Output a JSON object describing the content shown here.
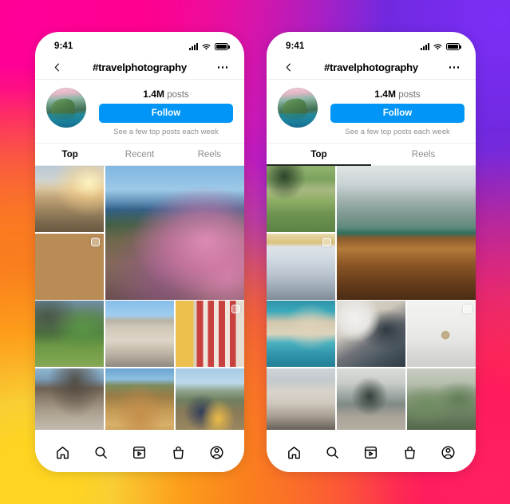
{
  "background": {
    "gradient_colors": [
      "#FF0099",
      "#7B2FF7",
      "#FF1B5C",
      "#FA7E1E",
      "#FFD521"
    ]
  },
  "accent": {
    "brand_blue": "#0095F6",
    "text_primary": "#000000",
    "text_muted": "#8e8e8e"
  },
  "phones": [
    {
      "id": "phone-left",
      "status": {
        "time": "9:41",
        "signal_icon": "cellular-bars-icon",
        "wifi_icon": "wifi-icon",
        "battery_icon": "battery-icon"
      },
      "header": {
        "back_icon": "chevron-left-icon",
        "title": "#travelphotography",
        "menu_icon": "more-options-icon"
      },
      "profile": {
        "avatar_name": "hashtag-avatar",
        "posts_count": "1.4M",
        "posts_label": "posts",
        "follow_label": "Follow",
        "subtext": "See a few top posts each week"
      },
      "tabs": [
        {
          "label": "Top",
          "active": true,
          "underline": false
        },
        {
          "label": "Recent",
          "active": false,
          "underline": false
        },
        {
          "label": "Reels",
          "active": false,
          "underline": false
        }
      ],
      "grid": [
        {
          "name": "post-beach-sunset",
          "art": "p-beach",
          "big": false,
          "badge": false
        },
        {
          "name": "post-coastal-flowers",
          "art": "p-flowers",
          "big": true,
          "badge": false
        },
        {
          "name": "post-coffee-cake",
          "art": "p-coffee",
          "big": false,
          "badge": true
        },
        {
          "name": "post-palm-garden",
          "art": "p-palm",
          "big": false,
          "badge": false
        },
        {
          "name": "post-stone-archway",
          "art": "p-arch",
          "big": false,
          "badge": false
        },
        {
          "name": "post-striped-wall-shadow",
          "art": "p-stripes",
          "big": false,
          "badge": true
        },
        {
          "name": "post-pebble-beach-cliff",
          "art": "p-cliff",
          "big": false,
          "badge": false
        },
        {
          "name": "post-hikers-trail",
          "art": "p-hikers",
          "big": false,
          "badge": false
        },
        {
          "name": "post-picnic-viewpoint",
          "art": "p-picnic",
          "big": false,
          "badge": false
        }
      ],
      "bottom_nav": [
        {
          "name": "nav-home",
          "icon": "home-icon"
        },
        {
          "name": "nav-search",
          "icon": "search-icon"
        },
        {
          "name": "nav-reels",
          "icon": "reels-icon"
        },
        {
          "name": "nav-shop",
          "icon": "shop-bag-icon"
        },
        {
          "name": "nav-profile",
          "icon": "profile-icon"
        }
      ]
    },
    {
      "id": "phone-right",
      "status": {
        "time": "9:41",
        "signal_icon": "cellular-bars-icon",
        "wifi_icon": "wifi-icon",
        "battery_icon": "battery-icon"
      },
      "header": {
        "back_icon": "chevron-left-icon",
        "title": "#travelphotography",
        "menu_icon": "more-options-icon"
      },
      "profile": {
        "avatar_name": "hashtag-avatar",
        "posts_count": "1.4M",
        "posts_label": "posts",
        "follow_label": "Follow",
        "subtext": "See a few top posts each week"
      },
      "tabs": [
        {
          "label": "Top",
          "active": true,
          "underline": true
        },
        {
          "label": "Reels",
          "active": false,
          "underline": false
        }
      ],
      "grid": [
        {
          "name": "post-alpine-hikers",
          "art": "p-alps",
          "big": false,
          "badge": false
        },
        {
          "name": "post-mountain-lake-boat",
          "art": "p-boat",
          "big": true,
          "badge": false
        },
        {
          "name": "post-airport-traveler",
          "art": "p-airport",
          "big": false,
          "badge": true
        },
        {
          "name": "post-turquoise-cove",
          "art": "p-cove",
          "big": false,
          "badge": false
        },
        {
          "name": "post-packed-suitcase",
          "art": "p-suitcase",
          "big": false,
          "badge": false
        },
        {
          "name": "post-globe-window",
          "art": "p-globe",
          "big": false,
          "badge": true
        },
        {
          "name": "post-city-street",
          "art": "p-street",
          "big": false,
          "badge": false
        },
        {
          "name": "post-photographer-camera",
          "art": "p-photog",
          "big": false,
          "badge": false
        },
        {
          "name": "post-plant-patio",
          "art": "p-plants",
          "big": false,
          "badge": false
        }
      ],
      "bottom_nav": [
        {
          "name": "nav-home",
          "icon": "home-icon"
        },
        {
          "name": "nav-search",
          "icon": "search-icon"
        },
        {
          "name": "nav-reels",
          "icon": "reels-icon"
        },
        {
          "name": "nav-shop",
          "icon": "shop-bag-icon"
        },
        {
          "name": "nav-profile",
          "icon": "profile-icon"
        }
      ]
    }
  ]
}
